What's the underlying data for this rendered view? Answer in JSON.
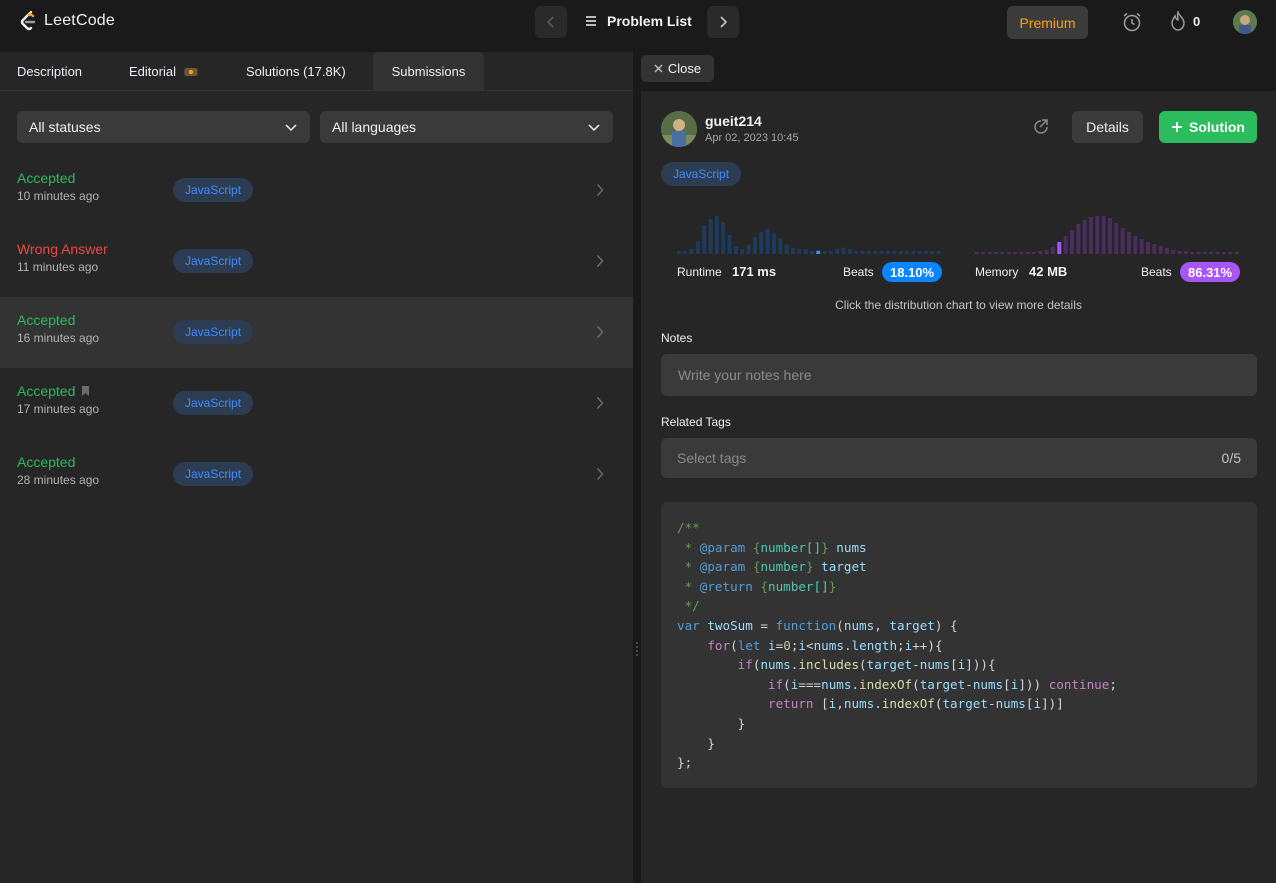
{
  "brand": {
    "name": "LeetCode"
  },
  "nav": {
    "problem_list": "Problem List",
    "premium": "Premium",
    "streak_count": "0"
  },
  "tabs": [
    {
      "label": "Description"
    },
    {
      "label": "Editorial"
    },
    {
      "label": "Solutions (17.8K)"
    },
    {
      "label": "Submissions"
    }
  ],
  "filters": {
    "status": "All statuses",
    "language": "All languages"
  },
  "submissions": [
    {
      "status": "Accepted",
      "time": "10 minutes ago",
      "lang": "JavaScript"
    },
    {
      "status": "Wrong Answer",
      "time": "11 minutes ago",
      "lang": "JavaScript"
    },
    {
      "status": "Accepted",
      "time": "16 minutes ago",
      "lang": "JavaScript"
    },
    {
      "status": "Accepted",
      "time": "17 minutes ago",
      "lang": "JavaScript"
    },
    {
      "status": "Accepted",
      "time": "28 minutes ago",
      "lang": "JavaScript"
    }
  ],
  "panel": {
    "close": "Close",
    "username": "gueit214",
    "date": "Apr 02, 2023 10:45",
    "details": "Details",
    "solution": "Solution",
    "lang": "JavaScript",
    "runtime_label": "Runtime",
    "runtime_value": "171 ms",
    "runtime_beats_label": "Beats",
    "runtime_beats": "18.10%",
    "memory_label": "Memory",
    "memory_value": "42 MB",
    "memory_beats_label": "Beats",
    "memory_beats": "86.31%",
    "hint": "Click the distribution chart to view more details",
    "notes_label": "Notes",
    "notes_placeholder": "Write your notes here",
    "tags_label": "Related Tags",
    "tags_placeholder": "Select tags",
    "tags_count": "0/5"
  },
  "colors": {
    "accepted": "#2cbb5d",
    "wrong": "#ef4743",
    "runtime_accent": "#3d8eff",
    "memory_accent": "#a855f7",
    "premium": "#ffa116"
  },
  "charts": {
    "runtime_bars": [
      2,
      2,
      3,
      8,
      18,
      22,
      24,
      20,
      12,
      5,
      3,
      6,
      11,
      14,
      16,
      13,
      10,
      6,
      4,
      3,
      3,
      2,
      2,
      2,
      2,
      3,
      4,
      3,
      2,
      2,
      2,
      2,
      2,
      2,
      2,
      2,
      2,
      2,
      2,
      2,
      2,
      2
    ],
    "runtime_highlight": 22,
    "memory_bars": [
      2,
      2,
      2,
      2,
      2,
      2,
      2,
      2,
      2,
      2,
      3,
      4,
      7,
      12,
      18,
      24,
      30,
      34,
      37,
      38,
      38,
      36,
      31,
      26,
      22,
      18,
      15,
      12,
      10,
      8,
      6,
      4,
      3,
      3,
      2,
      2,
      2,
      2,
      2,
      2,
      2,
      2
    ],
    "memory_highlight": 13
  }
}
